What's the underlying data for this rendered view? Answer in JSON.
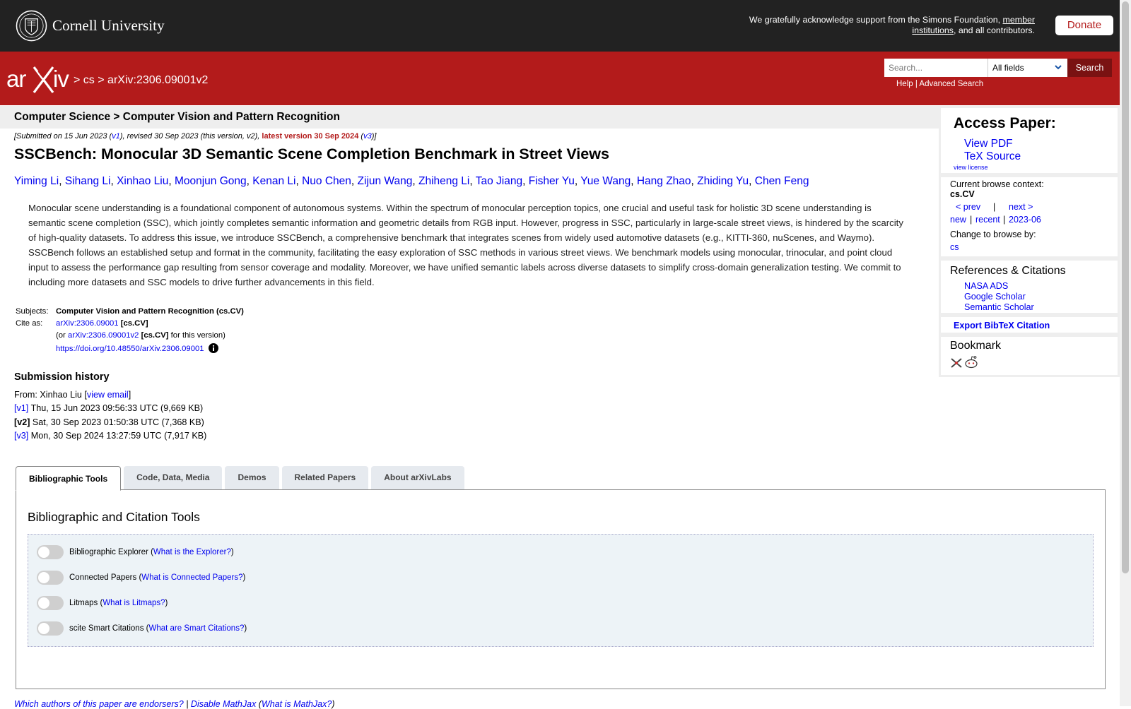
{
  "header": {
    "institution": "Cornell University",
    "ack_text": "We gratefully acknowledge support from the Simons Foundation,",
    "ack_link": "member institutions",
    "ack_tail": ", and all contributors.",
    "donate_label": "Donate"
  },
  "nav": {
    "logo_alt": "arXiv",
    "crumb_sep": ">",
    "crumb_1": "cs",
    "crumb_2": "arXiv:2306.09001v2",
    "search_placeholder": "Search...",
    "search_field": "All fields",
    "search_label": "Search",
    "help": "Help",
    "pipe": "|",
    "advanced": "Advanced Search"
  },
  "subject_header": "Computer Science > Computer Vision and Pattern Recognition",
  "dateline": {
    "submitted": "[Submitted on 15 Jun 2023 (",
    "v1": "v1",
    "revised": "), revised 30 Sep 2023 (this version, v2), ",
    "latest": "latest version 30 Sep 2024",
    "open": " (",
    "v3": "v3",
    "close": ")]"
  },
  "title": "SSCBench: Monocular 3D Semantic Scene Completion Benchmark in Street Views",
  "authors": [
    "Yiming Li",
    "Sihang Li",
    "Xinhao Liu",
    "Moonjun Gong",
    "Kenan Li",
    "Nuo Chen",
    "Zijun Wang",
    "Zhiheng Li",
    "Tao Jiang",
    "Fisher Yu",
    "Yue Wang",
    "Hang Zhao",
    "Zhiding Yu",
    "Chen Feng"
  ],
  "abstract": "Monocular scene understanding is a foundational component of autonomous systems. Within the spectrum of monocular perception topics, one crucial and useful task for holistic 3D scene understanding is semantic scene completion (SSC), which jointly completes semantic information and geometric details from RGB input. However, progress in SSC, particularly in large-scale street views, is hindered by the scarcity of high-quality datasets. To address this issue, we introduce SSCBench, a comprehensive benchmark that integrates scenes from widely used automotive datasets (e.g., KITTI-360, nuScenes, and Waymo). SSCBench follows an established setup and format in the community, facilitating the easy exploration of SSC methods in various street views. We benchmark models using monocular, trinocular, and point cloud input to assess the performance gap resulting from sensor coverage and modality. Moreover, we have unified semantic labels across diverse datasets to simplify cross-domain generalization testing. We commit to including more datasets and SSC models to drive further advancements in this field.",
  "meta": {
    "subjects_label": "Subjects:",
    "subjects_value": "Computer Vision and Pattern Recognition (cs.CV)",
    "cite_label": "Cite as:",
    "cite_id": "arXiv:2306.09001",
    "cite_cat": " [cs.CV]",
    "cite_ver_open": "(or ",
    "cite_ver_id": "arXiv:2306.09001v2",
    "cite_ver_cat": " [cs.CV]",
    "cite_ver_tail": " for this version)",
    "doi": "https://doi.org/10.48550/arXiv.2306.09001"
  },
  "submission_history": {
    "heading": "Submission history",
    "from_label": "From: Xinhao Liu [",
    "view_email": "view email",
    "from_close": "]",
    "versions": [
      {
        "tag": "[v1]",
        "detail": " Thu, 15 Jun 2023 09:56:33 UTC (9,669 KB)"
      },
      {
        "tag": "[v2]",
        "detail": " Sat, 30 Sep 2023 01:50:38 UTC (7,368 KB)"
      },
      {
        "tag": "[v3]",
        "detail": " Mon, 30 Sep 2024 13:27:59 UTC (7,917 KB)"
      }
    ]
  },
  "tabs": [
    "Bibliographic Tools",
    "Code, Data, Media",
    "Demos",
    "Related Papers",
    "About arXivLabs"
  ],
  "panel": {
    "heading": "Bibliographic and Citation Tools",
    "tools": [
      {
        "name": "Bibliographic Explorer",
        "link": "What is the Explorer?"
      },
      {
        "name": "Connected Papers",
        "link": "What is Connected Papers?"
      },
      {
        "name": "Litmaps",
        "link": "What is Litmaps?"
      },
      {
        "name": "scite Smart Citations",
        "link": "What are Smart Citations?"
      }
    ]
  },
  "bottom": {
    "endorsers": "Which authors of this paper are endorsers?",
    "pipe": " | ",
    "disable": "Disable MathJax",
    "what": "What is MathJax?"
  },
  "sidebar": {
    "access_heading": "Access Paper:",
    "view_pdf": "View PDF",
    "tex_source": "TeX Source",
    "view_license": "view license",
    "context_label": "Current browse context:",
    "context_value": "cs.CV",
    "prev": "< prev",
    "pipe": "|",
    "next": "next >",
    "new": "new",
    "recent": "recent",
    "month": "2023-06",
    "change_label": "Change to browse by:",
    "change_cs": "cs",
    "refs_heading": "References & Citations",
    "nasa": "NASA ADS",
    "google": "Google Scholar",
    "semantic": "Semantic Scholar",
    "export": "Export BibTeX Citation",
    "bookmark": "Bookmark"
  },
  "colors": {
    "arxiv_red": "#b31b1b",
    "top_bar": "#222222",
    "link": "#0000ee"
  }
}
